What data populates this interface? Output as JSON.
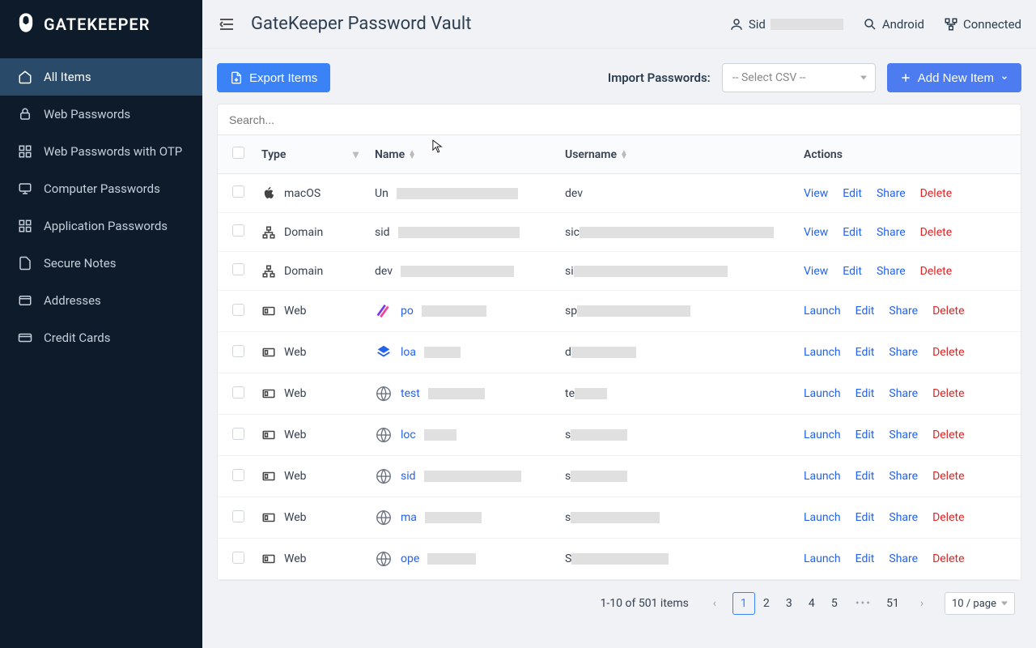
{
  "brand": "GATEKEEPER",
  "header": {
    "title": "GateKeeper Password Vault",
    "user_prefix": "Sid",
    "platform": "Android",
    "status": "Connected"
  },
  "sidebar": {
    "items": [
      {
        "label": "All Items",
        "active": true
      },
      {
        "label": "Web Passwords"
      },
      {
        "label": "Web Passwords with OTP"
      },
      {
        "label": "Computer Passwords"
      },
      {
        "label": "Application Passwords"
      },
      {
        "label": "Secure Notes"
      },
      {
        "label": "Addresses"
      },
      {
        "label": "Credit Cards"
      }
    ]
  },
  "toolbar": {
    "export_label": "Export Items",
    "import_label": "Import Passwords:",
    "select_csv_placeholder": "-- Select CSV --",
    "add_new_label": "Add New Item"
  },
  "search": {
    "placeholder": "Search..."
  },
  "table": {
    "headers": {
      "type": "Type",
      "name": "Name",
      "username": "Username",
      "actions": "Actions"
    },
    "rows": [
      {
        "type": "macOS",
        "type_icon": "apple",
        "name_prefix": "Un",
        "name_redact_w": 150,
        "name_link": false,
        "username_prefix": "dev",
        "username_redact_w": 0,
        "action1": "View"
      },
      {
        "type": "Domain",
        "type_icon": "domain",
        "name_prefix": "sid",
        "name_redact_w": 150,
        "name_link": false,
        "username_prefix": "sic",
        "username_redact_w": 240,
        "action1": "View"
      },
      {
        "type": "Domain",
        "type_icon": "domain",
        "name_prefix": "dev",
        "name_redact_w": 140,
        "name_link": false,
        "username_prefix": "si",
        "username_redact_w": 190,
        "action1": "View"
      },
      {
        "type": "Web",
        "type_icon": "web",
        "favicon": "po",
        "name_prefix": "po",
        "name_redact_w": 80,
        "name_link": true,
        "username_prefix": "sp",
        "username_redact_w": 140,
        "action1": "Launch"
      },
      {
        "type": "Web",
        "type_icon": "web",
        "favicon": "lo",
        "name_prefix": "loa",
        "name_redact_w": 45,
        "name_link": true,
        "username_prefix": "d",
        "username_redact_w": 80,
        "action1": "Launch"
      },
      {
        "type": "Web",
        "type_icon": "web",
        "favicon": "globe",
        "name_prefix": "test",
        "name_redact_w": 70,
        "name_link": true,
        "username_prefix": "te",
        "username_redact_w": 40,
        "action1": "Launch"
      },
      {
        "type": "Web",
        "type_icon": "web",
        "favicon": "globe",
        "name_prefix": "loc",
        "name_redact_w": 40,
        "name_link": true,
        "username_prefix": "s",
        "username_redact_w": 70,
        "action1": "Launch"
      },
      {
        "type": "Web",
        "type_icon": "web",
        "favicon": "globe",
        "name_prefix": "sid",
        "name_redact_w": 120,
        "name_link": true,
        "username_prefix": "s",
        "username_redact_w": 70,
        "action1": "Launch"
      },
      {
        "type": "Web",
        "type_icon": "web",
        "favicon": "globe",
        "name_prefix": "ma",
        "name_redact_w": 70,
        "name_link": true,
        "username_prefix": "s",
        "username_redact_w": 110,
        "action1": "Launch"
      },
      {
        "type": "Web",
        "type_icon": "web",
        "favicon": "globe",
        "name_prefix": "ope",
        "name_redact_w": 60,
        "name_link": true,
        "username_prefix": "S",
        "username_redact_w": 120,
        "action1": "Launch"
      }
    ],
    "common_actions": {
      "edit": "Edit",
      "share": "Share",
      "delete": "Delete"
    }
  },
  "pagination": {
    "summary": "1-10 of 501 items",
    "pages": [
      "1",
      "2",
      "3",
      "4",
      "5"
    ],
    "last_page": "51",
    "page_size": "10 / page"
  }
}
